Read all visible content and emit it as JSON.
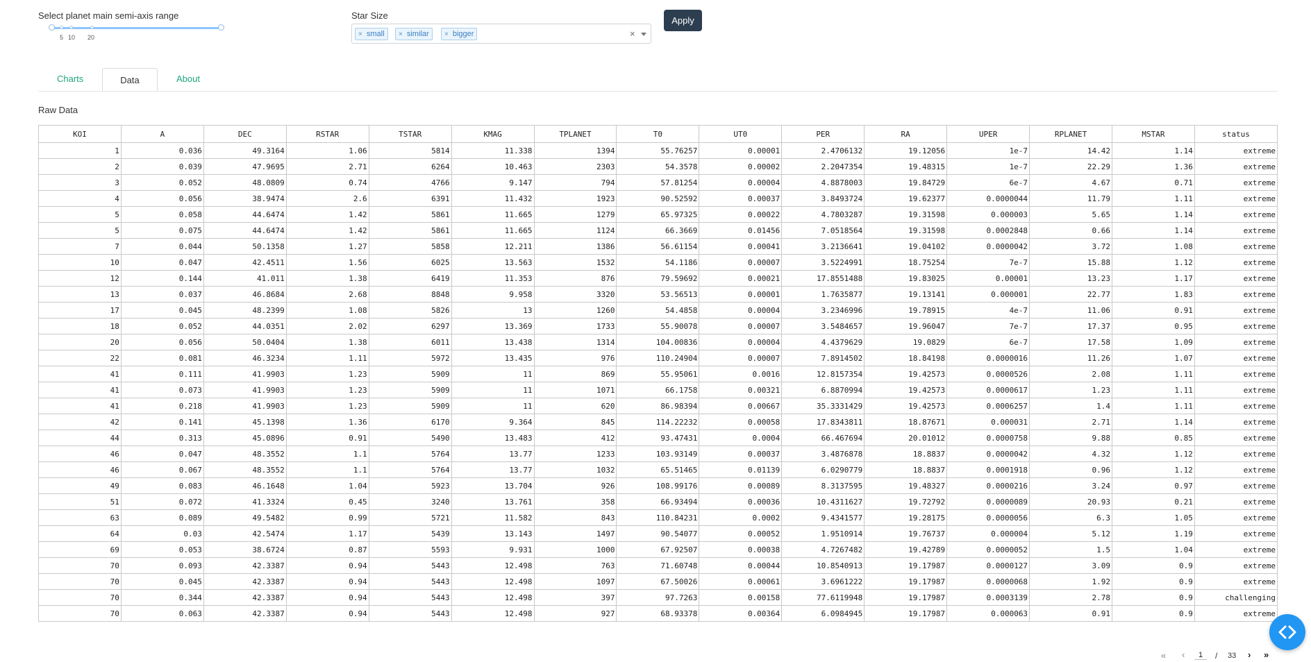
{
  "controls": {
    "slider": {
      "label": "Select planet main semi-axis range",
      "ticks": [
        "5",
        "10",
        "20"
      ]
    },
    "star_size": {
      "label": "Star Size",
      "chips": [
        "small",
        "similar",
        "bigger"
      ],
      "chip_remove_glyph": "×",
      "clear_glyph": "×"
    },
    "apply_label": "Apply"
  },
  "tabs": [
    {
      "label": "Charts",
      "active": false
    },
    {
      "label": "Data",
      "active": true
    },
    {
      "label": "About",
      "active": false
    }
  ],
  "section_title": "Raw Data",
  "table": {
    "columns": [
      "KOI",
      "A",
      "DEC",
      "RSTAR",
      "TSTAR",
      "KMAG",
      "TPLANET",
      "T0",
      "UT0",
      "PER",
      "RA",
      "UPER",
      "RPLANET",
      "MSTAR",
      "status"
    ],
    "rows": [
      [
        "1",
        "0.036",
        "49.3164",
        "1.06",
        "5814",
        "11.338",
        "1394",
        "55.76257",
        "0.00001",
        "2.4706132",
        "19.12056",
        "1e-7",
        "14.42",
        "1.14",
        "extreme"
      ],
      [
        "2",
        "0.039",
        "47.9695",
        "2.71",
        "6264",
        "10.463",
        "2303",
        "54.3578",
        "0.00002",
        "2.2047354",
        "19.48315",
        "1e-7",
        "22.29",
        "1.36",
        "extreme"
      ],
      [
        "3",
        "0.052",
        "48.0809",
        "0.74",
        "4766",
        "9.147",
        "794",
        "57.81254",
        "0.00004",
        "4.8878003",
        "19.84729",
        "6e-7",
        "4.67",
        "0.71",
        "extreme"
      ],
      [
        "4",
        "0.056",
        "38.9474",
        "2.6",
        "6391",
        "11.432",
        "1923",
        "90.52592",
        "0.00037",
        "3.8493724",
        "19.62377",
        "0.0000044",
        "11.79",
        "1.11",
        "extreme"
      ],
      [
        "5",
        "0.058",
        "44.6474",
        "1.42",
        "5861",
        "11.665",
        "1279",
        "65.97325",
        "0.00022",
        "4.7803287",
        "19.31598",
        "0.000003",
        "5.65",
        "1.14",
        "extreme"
      ],
      [
        "5",
        "0.075",
        "44.6474",
        "1.42",
        "5861",
        "11.665",
        "1124",
        "66.3669",
        "0.01456",
        "7.0518564",
        "19.31598",
        "0.0002848",
        "0.66",
        "1.14",
        "extreme"
      ],
      [
        "7",
        "0.044",
        "50.1358",
        "1.27",
        "5858",
        "12.211",
        "1386",
        "56.61154",
        "0.00041",
        "3.2136641",
        "19.04102",
        "0.0000042",
        "3.72",
        "1.08",
        "extreme"
      ],
      [
        "10",
        "0.047",
        "42.4511",
        "1.56",
        "6025",
        "13.563",
        "1532",
        "54.1186",
        "0.00007",
        "3.5224991",
        "18.75254",
        "7e-7",
        "15.88",
        "1.12",
        "extreme"
      ],
      [
        "12",
        "0.144",
        "41.011",
        "1.38",
        "6419",
        "11.353",
        "876",
        "79.59692",
        "0.00021",
        "17.8551488",
        "19.83025",
        "0.00001",
        "13.23",
        "1.17",
        "extreme"
      ],
      [
        "13",
        "0.037",
        "46.8684",
        "2.68",
        "8848",
        "9.958",
        "3320",
        "53.56513",
        "0.00001",
        "1.7635877",
        "19.13141",
        "0.000001",
        "22.77",
        "1.83",
        "extreme"
      ],
      [
        "17",
        "0.045",
        "48.2399",
        "1.08",
        "5826",
        "13",
        "1260",
        "54.4858",
        "0.00004",
        "3.2346996",
        "19.78915",
        "4e-7",
        "11.06",
        "0.91",
        "extreme"
      ],
      [
        "18",
        "0.052",
        "44.0351",
        "2.02",
        "6297",
        "13.369",
        "1733",
        "55.90078",
        "0.00007",
        "3.5484657",
        "19.96047",
        "7e-7",
        "17.37",
        "0.95",
        "extreme"
      ],
      [
        "20",
        "0.056",
        "50.0404",
        "1.38",
        "6011",
        "13.438",
        "1314",
        "104.00836",
        "0.00004",
        "4.4379629",
        "19.0829",
        "6e-7",
        "17.58",
        "1.09",
        "extreme"
      ],
      [
        "22",
        "0.081",
        "46.3234",
        "1.11",
        "5972",
        "13.435",
        "976",
        "110.24904",
        "0.00007",
        "7.8914502",
        "18.84198",
        "0.0000016",
        "11.26",
        "1.07",
        "extreme"
      ],
      [
        "41",
        "0.111",
        "41.9903",
        "1.23",
        "5909",
        "11",
        "869",
        "55.95061",
        "0.0016",
        "12.8157354",
        "19.42573",
        "0.0000526",
        "2.08",
        "1.11",
        "extreme"
      ],
      [
        "41",
        "0.073",
        "41.9903",
        "1.23",
        "5909",
        "11",
        "1071",
        "66.1758",
        "0.00321",
        "6.8870994",
        "19.42573",
        "0.0000617",
        "1.23",
        "1.11",
        "extreme"
      ],
      [
        "41",
        "0.218",
        "41.9903",
        "1.23",
        "5909",
        "11",
        "620",
        "86.98394",
        "0.00667",
        "35.3331429",
        "19.42573",
        "0.0006257",
        "1.4",
        "1.11",
        "extreme"
      ],
      [
        "42",
        "0.141",
        "45.1398",
        "1.36",
        "6170",
        "9.364",
        "845",
        "114.22232",
        "0.00058",
        "17.8343811",
        "18.87671",
        "0.000031",
        "2.71",
        "1.14",
        "extreme"
      ],
      [
        "44",
        "0.313",
        "45.0896",
        "0.91",
        "5490",
        "13.483",
        "412",
        "93.47431",
        "0.0004",
        "66.467694",
        "20.01012",
        "0.0000758",
        "9.88",
        "0.85",
        "extreme"
      ],
      [
        "46",
        "0.047",
        "48.3552",
        "1.1",
        "5764",
        "13.77",
        "1233",
        "103.93149",
        "0.00037",
        "3.4876878",
        "18.8837",
        "0.0000042",
        "4.32",
        "1.12",
        "extreme"
      ],
      [
        "46",
        "0.067",
        "48.3552",
        "1.1",
        "5764",
        "13.77",
        "1032",
        "65.51465",
        "0.01139",
        "6.0290779",
        "18.8837",
        "0.0001918",
        "0.96",
        "1.12",
        "extreme"
      ],
      [
        "49",
        "0.083",
        "46.1648",
        "1.04",
        "5923",
        "13.704",
        "926",
        "108.99176",
        "0.00089",
        "8.3137595",
        "19.48327",
        "0.0000216",
        "3.24",
        "0.97",
        "extreme"
      ],
      [
        "51",
        "0.072",
        "41.3324",
        "0.45",
        "3240",
        "13.761",
        "358",
        "66.93494",
        "0.00036",
        "10.4311627",
        "19.72792",
        "0.0000089",
        "20.93",
        "0.21",
        "extreme"
      ],
      [
        "63",
        "0.089",
        "49.5482",
        "0.99",
        "5721",
        "11.582",
        "843",
        "110.84231",
        "0.0002",
        "9.4341577",
        "19.28175",
        "0.0000056",
        "6.3",
        "1.05",
        "extreme"
      ],
      [
        "64",
        "0.03",
        "42.5474",
        "1.17",
        "5439",
        "13.143",
        "1497",
        "90.54077",
        "0.00052",
        "1.9510914",
        "19.76737",
        "0.000004",
        "5.12",
        "1.19",
        "extreme"
      ],
      [
        "69",
        "0.053",
        "38.6724",
        "0.87",
        "5593",
        "9.931",
        "1000",
        "67.92507",
        "0.00038",
        "4.7267482",
        "19.42789",
        "0.0000052",
        "1.5",
        "1.04",
        "extreme"
      ],
      [
        "70",
        "0.093",
        "42.3387",
        "0.94",
        "5443",
        "12.498",
        "763",
        "71.60748",
        "0.00044",
        "10.8540913",
        "19.17987",
        "0.0000127",
        "3.09",
        "0.9",
        "extreme"
      ],
      [
        "70",
        "0.045",
        "42.3387",
        "0.94",
        "5443",
        "12.498",
        "1097",
        "67.50026",
        "0.00061",
        "3.6961222",
        "19.17987",
        "0.0000068",
        "1.92",
        "0.9",
        "extreme"
      ],
      [
        "70",
        "0.344",
        "42.3387",
        "0.94",
        "5443",
        "12.498",
        "397",
        "97.7263",
        "0.00158",
        "77.6119948",
        "19.17987",
        "0.0003139",
        "2.78",
        "0.9",
        "challenging"
      ],
      [
        "70",
        "0.063",
        "42.3387",
        "0.94",
        "5443",
        "12.498",
        "927",
        "68.93378",
        "0.00364",
        "6.0984945",
        "19.17987",
        "0.000063",
        "0.91",
        "0.9",
        "extreme"
      ]
    ]
  },
  "pagination": {
    "first": "«",
    "prev": "‹",
    "current": "1",
    "separator": "/",
    "total": "33",
    "next": "›",
    "last": "»"
  }
}
